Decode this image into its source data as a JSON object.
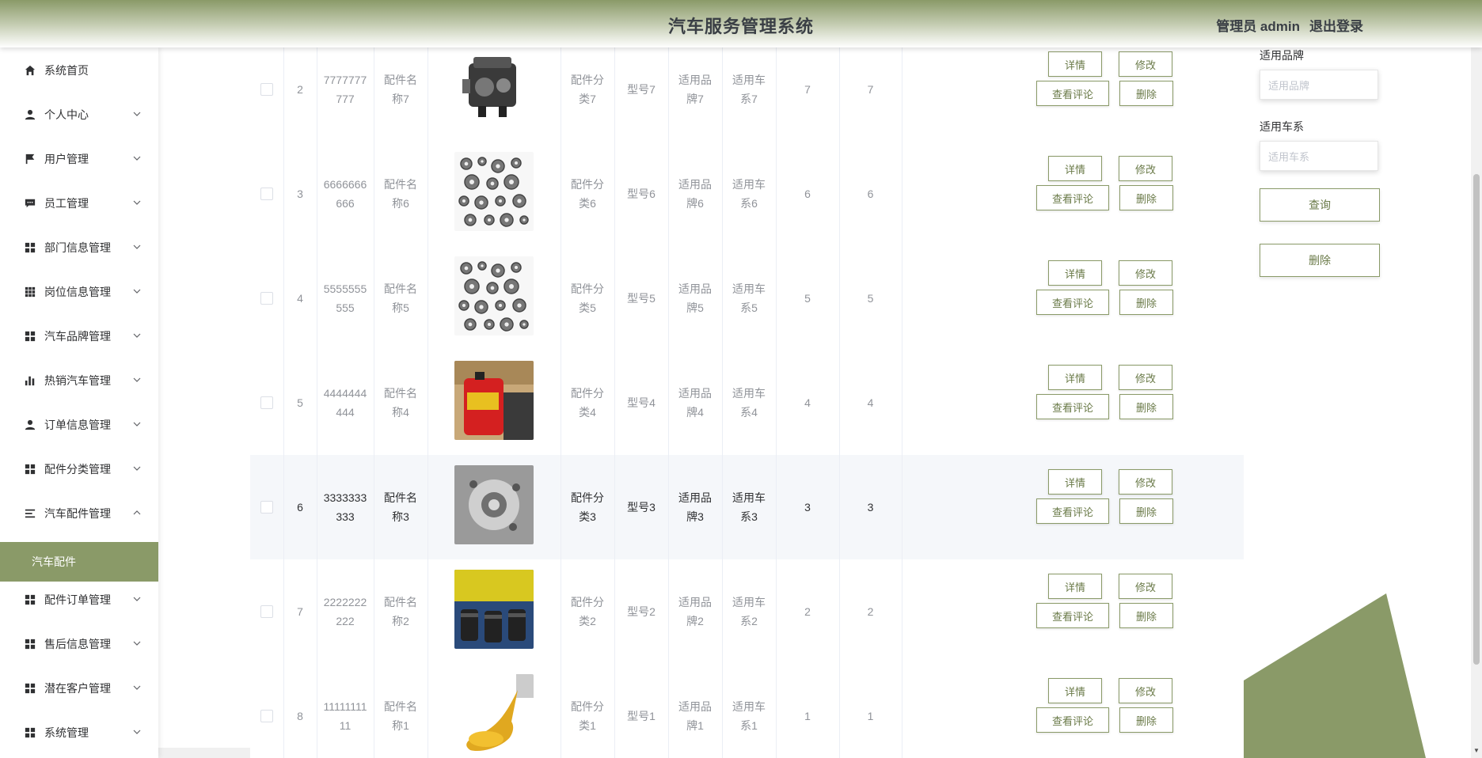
{
  "header": {
    "title": "汽车服务管理系统",
    "user": "管理员 admin",
    "logout": "退出登录"
  },
  "colors": {
    "accent": "#8a9a68",
    "sidebar_active_bg": "#8a9a68",
    "text": "#303133"
  },
  "sidebar": {
    "items": [
      {
        "label": "系统首页",
        "icon": "home-icon",
        "expandable": false
      },
      {
        "label": "个人中心",
        "icon": "user-icon",
        "expandable": true
      },
      {
        "label": "用户管理",
        "icon": "flag-icon",
        "expandable": true
      },
      {
        "label": "员工管理",
        "icon": "chat-icon",
        "expandable": true
      },
      {
        "label": "部门信息管理",
        "icon": "grid-icon",
        "expandable": true
      },
      {
        "label": "岗位信息管理",
        "icon": "grid9-icon",
        "expandable": true
      },
      {
        "label": "汽车品牌管理",
        "icon": "grid-icon",
        "expandable": true
      },
      {
        "label": "热销汽车管理",
        "icon": "bar-chart-icon",
        "expandable": true
      },
      {
        "label": "订单信息管理",
        "icon": "user-icon",
        "expandable": true
      },
      {
        "label": "配件分类管理",
        "icon": "grid-icon",
        "expandable": true
      },
      {
        "label": "汽车配件管理",
        "icon": "list-icon",
        "expandable": true,
        "expanded": true
      },
      {
        "label": "配件订单管理",
        "icon": "grid-icon",
        "expandable": true
      },
      {
        "label": "售后信息管理",
        "icon": "grid-icon",
        "expandable": true
      },
      {
        "label": "潜在客户管理",
        "icon": "grid-icon",
        "expandable": true
      },
      {
        "label": "系统管理",
        "icon": "grid-icon",
        "expandable": true
      }
    ],
    "active_sub": "汽车配件"
  },
  "table": {
    "rows": [
      {
        "index": "2",
        "code": "7777777777",
        "name": "配件名称7",
        "image": "engine",
        "category": "配件分类7",
        "model": "型号7",
        "brand": "适用品牌7",
        "series": "适用车系7",
        "c1": "7",
        "c2": "7",
        "highlight": false
      },
      {
        "index": "3",
        "code": "6666666666",
        "name": "配件名称6",
        "image": "gears",
        "category": "配件分类6",
        "model": "型号6",
        "brand": "适用品牌6",
        "series": "适用车系6",
        "c1": "6",
        "c2": "6",
        "highlight": false
      },
      {
        "index": "4",
        "code": "5555555555",
        "name": "配件名称5",
        "image": "gears",
        "category": "配件分类5",
        "model": "型号5",
        "brand": "适用品牌5",
        "series": "适用车系5",
        "c1": "5",
        "c2": "5",
        "highlight": false
      },
      {
        "index": "5",
        "code": "4444444444",
        "name": "配件名称4",
        "image": "oil-can",
        "category": "配件分类4",
        "model": "型号4",
        "brand": "适用品牌4",
        "series": "适用车系4",
        "c1": "4",
        "c2": "4",
        "highlight": false
      },
      {
        "index": "6",
        "code": "3333333333",
        "name": "配件名称3",
        "image": "pump",
        "category": "配件分类3",
        "model": "型号3",
        "brand": "适用品牌3",
        "series": "适用车系3",
        "c1": "3",
        "c2": "3",
        "highlight": true
      },
      {
        "index": "7",
        "code": "2222222222",
        "name": "配件名称2",
        "image": "filters",
        "category": "配件分类2",
        "model": "型号2",
        "brand": "适用品牌2",
        "series": "适用车系2",
        "c1": "2",
        "c2": "2",
        "highlight": false
      },
      {
        "index": "8",
        "code": "1111111111",
        "name": "配件名称1",
        "image": "oil-pour",
        "category": "配件分类1",
        "model": "型号1",
        "brand": "适用品牌1",
        "series": "适用车系1",
        "c1": "1",
        "c2": "1",
        "highlight": false
      }
    ],
    "actions": {
      "detail": "详情",
      "edit": "修改",
      "comments": "查看评论",
      "delete": "删除"
    }
  },
  "search": {
    "brand_label": "适用品牌",
    "brand_placeholder": "适用品牌",
    "series_label": "适用车系",
    "series_placeholder": "适用车系",
    "query_button": "查询",
    "delete_button": "删除"
  }
}
